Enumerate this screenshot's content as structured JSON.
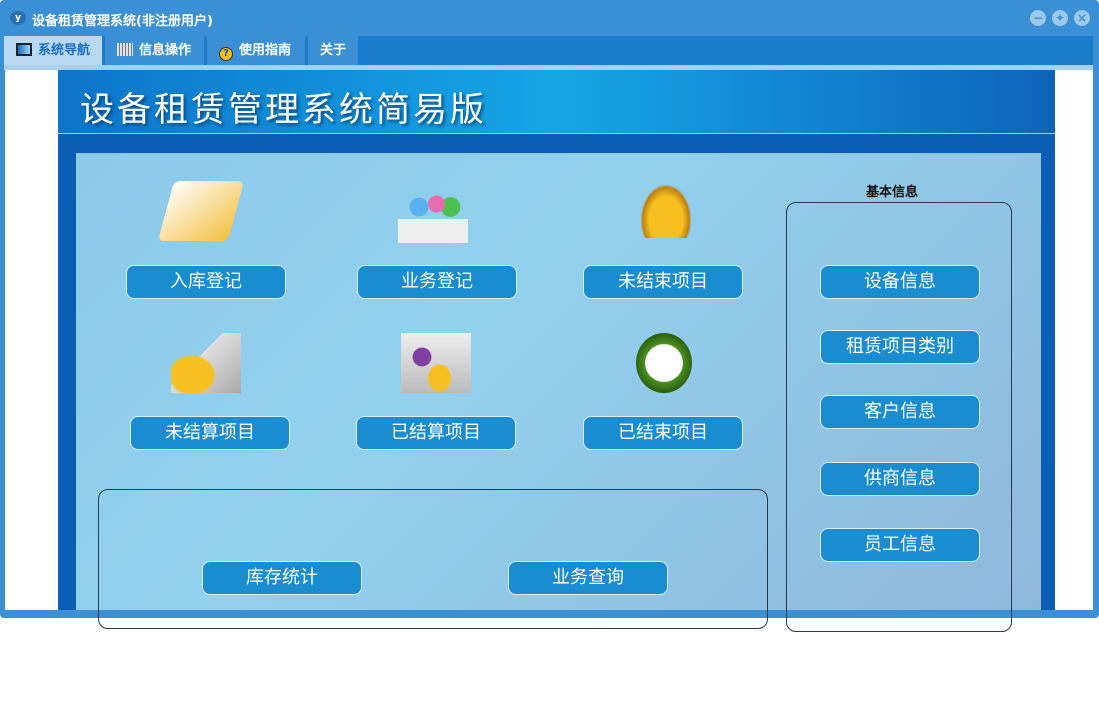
{
  "window": {
    "title": "设备租赁管理系统(非注册用户)",
    "logo": "YF"
  },
  "tabs": [
    {
      "label": "系统导航",
      "icon": "monitor-icon"
    },
    {
      "label": "信息操作",
      "icon": "grid-icon"
    },
    {
      "label": "使用指南",
      "icon": "help-icon"
    },
    {
      "label": "关于"
    }
  ],
  "banner": {
    "title": "设备租赁管理系统简易版"
  },
  "actions": [
    "入库登记",
    "业务登记",
    "未结束项目",
    "未结算项目",
    "已结算项目",
    "已结束项目"
  ],
  "stats": [
    "库存统计",
    "业务查询"
  ],
  "basic_info": {
    "title": "基本信息",
    "items": [
      "设备信息",
      "租赁项目类别",
      "客户信息",
      "供商信息",
      "员工信息"
    ]
  }
}
